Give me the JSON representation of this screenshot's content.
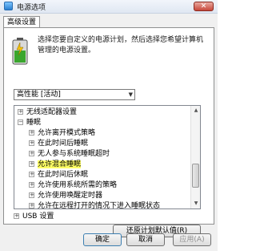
{
  "window": {
    "title": "电源选项",
    "close_glyph": "✕"
  },
  "tab": {
    "label": "高级设置"
  },
  "description": "选择您要自定义的电源计划，然后选择您希望计算机管理的电源设置。",
  "plan": {
    "selected": "高性能 [活动]",
    "arrow": "▼"
  },
  "tree": {
    "items": [
      {
        "expander": "+",
        "label": "无线适配器设置"
      },
      {
        "expander": "−",
        "label": "睡眠"
      },
      {
        "expander": "+",
        "label": "允许离开模式策略"
      },
      {
        "expander": "+",
        "label": "在此时间后睡眠"
      },
      {
        "expander": "+",
        "label": "无人参与系统睡眠超时"
      },
      {
        "expander": "+",
        "label": "允许混合睡眠"
      },
      {
        "expander": "+",
        "label": "在此时间后休眠"
      },
      {
        "expander": "+",
        "label": "允许使用系统所需的策略"
      },
      {
        "expander": "+",
        "label": "允许使用唤醒定时器"
      },
      {
        "expander": "+",
        "label": "允许在远程打开的情况下进入睡眠状态"
      },
      {
        "expander": "+",
        "label": "USB 设置"
      }
    ]
  },
  "buttons": {
    "restore": "还原计划默认值(R)",
    "ok": "确定",
    "cancel": "取消",
    "apply": "应用(A)"
  }
}
